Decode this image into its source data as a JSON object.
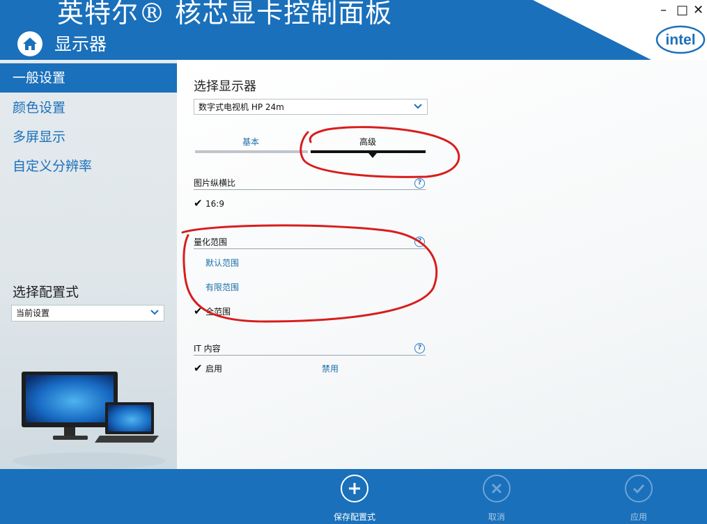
{
  "header": {
    "app_title": "英特尔® 核芯显卡控制面板",
    "section_title": "显示器",
    "logo_text": "intel",
    "window_controls": {
      "minimize": "–",
      "maximize": "□",
      "close": "✕"
    }
  },
  "sidebar": {
    "items": [
      {
        "label": "一般设置",
        "active": true
      },
      {
        "label": "颜色设置",
        "active": false
      },
      {
        "label": "多屏显示",
        "active": false
      },
      {
        "label": "自定义分辨率",
        "active": false
      }
    ],
    "profile_label": "选择配置式",
    "profile_value": "当前设置"
  },
  "main": {
    "select_display_label": "选择显示器",
    "select_display_value": "数字式电视机 HP 24m",
    "tabs": [
      {
        "label": "基本",
        "active": false
      },
      {
        "label": "高级",
        "active": true
      }
    ],
    "aspect": {
      "title": "图片纵横比",
      "option": "16:9",
      "help": "?"
    },
    "quant": {
      "title": "量化范围",
      "help": "?",
      "options": [
        "默认范围",
        "有限范围",
        "全范围"
      ],
      "selected": "全范围"
    },
    "it_content": {
      "title": "IT 内容",
      "help": "?",
      "enable": "启用",
      "disable": "禁用",
      "selected": "启用"
    }
  },
  "footer": {
    "save": "保存配置式",
    "cancel": "取消",
    "apply": "应用"
  },
  "colors": {
    "brand_blue": "#1a70bb",
    "annotation_red": "#d91c1c"
  }
}
